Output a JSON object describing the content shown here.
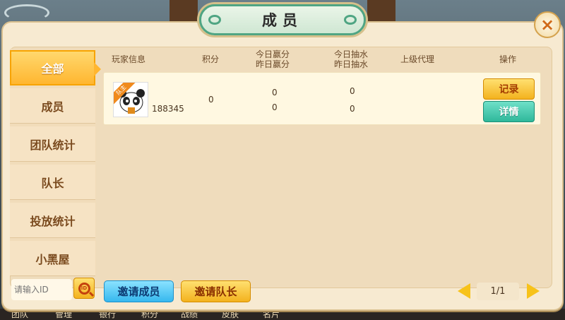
{
  "dialog": {
    "title": "成员",
    "close_icon": "close-x-icon"
  },
  "sidebar": {
    "items": [
      {
        "label": "全部",
        "active": true
      },
      {
        "label": "成员",
        "active": false
      },
      {
        "label": "团队统计",
        "active": false
      },
      {
        "label": "队长",
        "active": false
      },
      {
        "label": "投放统计",
        "active": false
      },
      {
        "label": "小黑屋",
        "active": false
      }
    ]
  },
  "table": {
    "headers": {
      "player_info": "玩家信息",
      "score": "积分",
      "win_today": "今日赢分",
      "win_yesterday": "昨日赢分",
      "draw_today": "今日抽水",
      "draw_yesterday": "昨日抽水",
      "superior": "上级代理",
      "action": "操作"
    },
    "rows": [
      {
        "badge": "队主",
        "player_id": "188345",
        "score": "0",
        "win_today": "0",
        "win_yesterday": "0",
        "draw_today": "0",
        "draw_yesterday": "0",
        "superior": "",
        "record_label": "记录",
        "detail_label": "详情"
      }
    ]
  },
  "footer": {
    "search_placeholder": "请输入ID",
    "search_icon_text": "ID",
    "invite_member_label": "邀请成员",
    "invite_leader_label": "邀请队长",
    "page_label": "1/1"
  },
  "background_tabs": [
    "团队",
    "管理",
    "银行",
    "积分",
    "战绩",
    "皮肤",
    "名片"
  ],
  "colors": {
    "panel": "#f7ead1",
    "active_tab": "#ffb630",
    "record_button": "#f3b21e",
    "detail_button": "#2fb89b",
    "invite_member_button": "#36b8ee"
  }
}
